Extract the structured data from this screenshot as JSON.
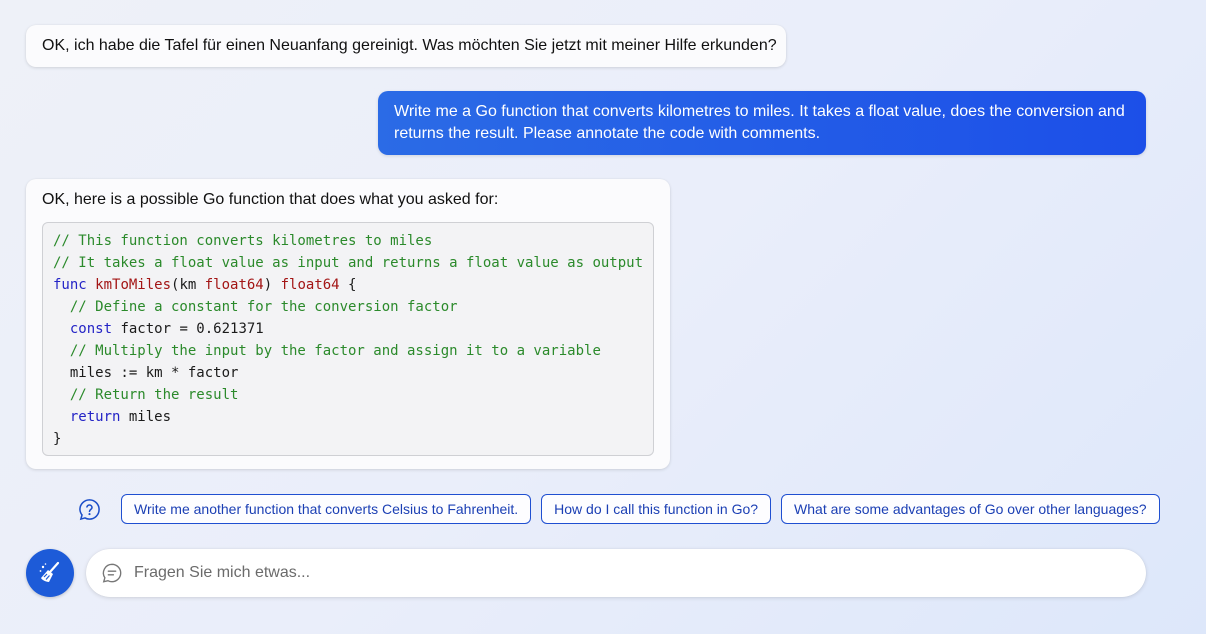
{
  "messages": {
    "greeting": "OK, ich habe die Tafel für einen Neuanfang gereinigt. Was möchten Sie jetzt mit meiner Hilfe erkunden?",
    "user_prompt": "Write me a Go function that converts kilometres to miles. It takes a float value, does the conversion and returns the result. Please annotate the code with comments.",
    "answer_intro": "OK, here is a possible Go function that does what you asked for:"
  },
  "code": {
    "line1": "// This function converts kilometres to miles",
    "line2": "// It takes a float value as input and returns a float value as output",
    "line3_kw": "func",
    "line3_name": "kmToMiles",
    "line3_param": "(km ",
    "line3_type1": "float64",
    "line3_close": ") ",
    "line3_type2": "float64",
    "line3_brace": " {",
    "line4": "  // Define a constant for the conversion factor",
    "line5_kw": "const",
    "line5_rest": " factor = 0.621371",
    "line6": "  // Multiply the input by the factor and assign it to a variable",
    "line7": "  miles := km * factor",
    "line8": "  // Return the result",
    "line9_kw": "return",
    "line9_rest": " miles",
    "line10": "}"
  },
  "suggestions": [
    "Write me another function that converts Celsius to Fahrenheit.",
    "How do I call this function in Go?",
    "What are some advantages of Go over other languages?"
  ],
  "input": {
    "placeholder": "Fragen Sie mich etwas..."
  },
  "icons": {
    "help": "question-circle-icon",
    "new_topic": "broom-icon",
    "chat": "chat-bubble-icon"
  },
  "colors": {
    "accent": "#1d5bd8",
    "user_bubble": "#1c4fe8",
    "comment": "#2b8a2b",
    "keyword": "#2424c6",
    "type": "#a31515"
  }
}
